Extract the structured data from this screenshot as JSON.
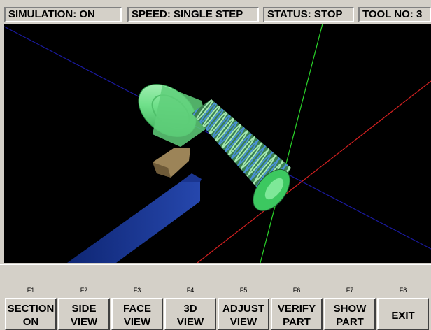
{
  "status": {
    "simulation": "SIMULATION: ON",
    "speed": "SPEED: SINGLE STEP",
    "state": "STATUS: STOP",
    "tool": "TOOL NO: 3"
  },
  "viewport": {
    "background": "#000000",
    "part_color": "#6fe08a",
    "thread_color": "#4a90d8",
    "tool_color": "#9c8458",
    "holder_color": "#1f3fa0",
    "axis_colors": {
      "x": "#d22020",
      "y": "#2ad42a",
      "z": "#1a1aa0"
    }
  },
  "function_keys": [
    {
      "key": "F1",
      "line1": "SECTION",
      "line2": "ON"
    },
    {
      "key": "F2",
      "line1": "SIDE",
      "line2": "VIEW"
    },
    {
      "key": "F3",
      "line1": "FACE",
      "line2": "VIEW"
    },
    {
      "key": "F4",
      "line1": "3D",
      "line2": "VIEW"
    },
    {
      "key": "F5",
      "line1": "ADJUST",
      "line2": "VIEW"
    },
    {
      "key": "F6",
      "line1": "VERIFY",
      "line2": "PART"
    },
    {
      "key": "F7",
      "line1": "SHOW",
      "line2": "PART"
    },
    {
      "key": "F8",
      "line1": "EXIT",
      "line2": ""
    }
  ]
}
